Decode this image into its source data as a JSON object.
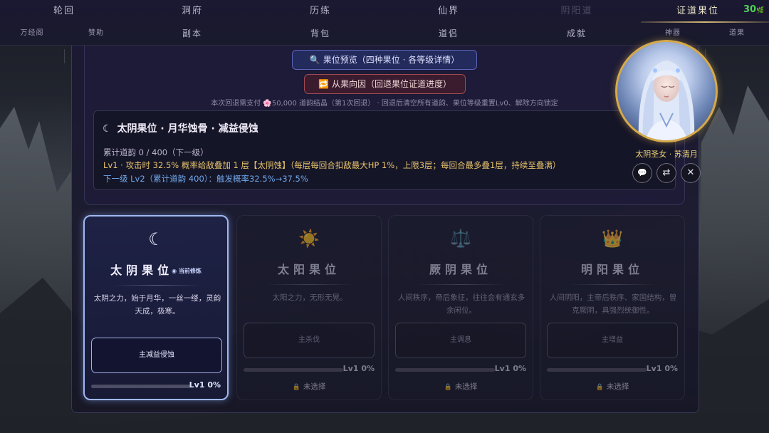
{
  "nav": {
    "row1": [
      "轮回",
      "洞府",
      "历练",
      "仙界",
      "阴阳道",
      "证道果位"
    ],
    "row2": [
      "万经阁",
      "赞助",
      "副本",
      "背包",
      "道侣",
      "成就",
      "神器",
      "道果"
    ],
    "counter": "30",
    "counter_icon": "leaf-icon"
  },
  "preview_button": {
    "icon": "🔍",
    "label": "果位预览（四种果位 · 各等级详情）"
  },
  "reverse_button": {
    "icon": "🔁",
    "label": "从果向因（回退果位证道进度）"
  },
  "cost_note": "本次回退需支付 🌸50,000 道韵结晶（第1次回退） · 回退后清空所有道韵、果位等级重置Lv0、解除方向锁定",
  "detail": {
    "moon_icon": "☾",
    "title": "太阴果位 · 月华蚀骨 · 减益侵蚀",
    "line1": "累计道韵 0 / 400（下一级）",
    "line2": "Lv1 · 攻击时 32.5% 概率给敌叠加 1 层【太阴蚀】（每层每回合扣敌最大HP 1%，上限3层；每回合最多叠1层，持续至叠满）",
    "line3": "下一级 Lv2（累计道韵 400）：触发概率32.5%→37.5%"
  },
  "portrait": {
    "name": "太阴圣女 · 苏清月"
  },
  "round_buttons": [
    {
      "name": "chat-button",
      "icon": "💬"
    },
    {
      "name": "swap-button",
      "icon": "⇄"
    },
    {
      "name": "close-button",
      "icon": "✕"
    }
  ],
  "cards": [
    {
      "icon": "☾",
      "title": "太阴果位",
      "current_tag": "◉ 当前修炼",
      "desc": "太阴之力，始于月华，一丝一缕，灵韵天成，极寒。",
      "action": "主减益侵蚀",
      "progress_label": "Lv1 0%",
      "progress": 0,
      "status": ""
    },
    {
      "icon": "☀️",
      "title": "太阳果位",
      "current_tag": "",
      "desc": "太阳之力，无形无晃。",
      "action": "主杀伐",
      "progress_label": "Lv1 0%",
      "progress": 0,
      "status": "未选择"
    },
    {
      "icon": "⚖️",
      "title": "厥阴果位",
      "current_tag": "",
      "desc": "人间秩序，帝后象征，往往会有通玄多余闲位。",
      "action": "主调息",
      "progress_label": "Lv1 0%",
      "progress": 0,
      "status": "未选择"
    },
    {
      "icon": "👑",
      "title": "明阳果位",
      "current_tag": "",
      "desc": "人间阴阳，主帝后秩序、家国结构，曾克厥阴，具强烈统御性。",
      "action": "主增益",
      "progress_label": "Lv1 0%",
      "progress": 0,
      "status": "未选择"
    }
  ],
  "colors": {
    "accent_gold": "#d6b878",
    "counter_green": "#4fd05a",
    "line2_yellow": "#e6c36b",
    "line3_blue": "#6fa8e8",
    "active_border": "#9fb8f0"
  }
}
